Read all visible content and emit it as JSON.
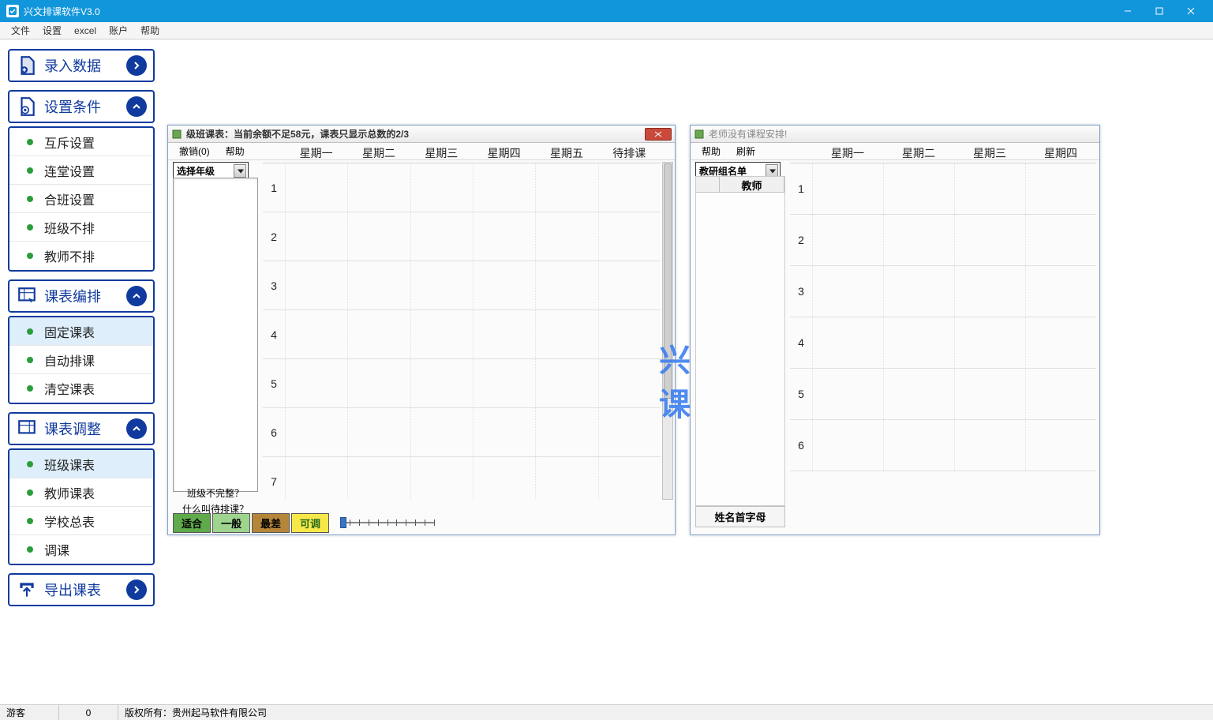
{
  "titlebar": {
    "title": "兴文排课软件V3.0"
  },
  "menubar": {
    "items": [
      "文件",
      "设置",
      "excel",
      "账户",
      "帮助"
    ]
  },
  "sidebar": {
    "sections": [
      {
        "id": "input-data",
        "label": "录入数据",
        "icon": "doc-add",
        "arrow": "right",
        "expanded": false,
        "items": []
      },
      {
        "id": "set-conditions",
        "label": "设置条件",
        "icon": "doc-gear",
        "arrow": "up",
        "expanded": true,
        "items": [
          {
            "id": "exclusion",
            "label": "互斥设置"
          },
          {
            "id": "consecutive",
            "label": "连堂设置"
          },
          {
            "id": "merge-class",
            "label": "合班设置"
          },
          {
            "id": "class-no-schedule",
            "label": "班级不排"
          },
          {
            "id": "teacher-no-schedule",
            "label": "教师不排"
          }
        ]
      },
      {
        "id": "schedule-arrange",
        "label": "课表编排",
        "icon": "grid-cursor",
        "arrow": "up",
        "expanded": true,
        "items": [
          {
            "id": "fixed-schedule",
            "label": "固定课表",
            "active": true
          },
          {
            "id": "auto-schedule",
            "label": "自动排课"
          },
          {
            "id": "clear-schedule",
            "label": "清空课表"
          }
        ]
      },
      {
        "id": "schedule-adjust",
        "label": "课表调整",
        "icon": "grid-box",
        "arrow": "up",
        "expanded": true,
        "items": [
          {
            "id": "class-schedule",
            "label": "班级课表",
            "active": true
          },
          {
            "id": "teacher-schedule",
            "label": "教师课表"
          },
          {
            "id": "school-all",
            "label": "学校总表"
          },
          {
            "id": "swap-class",
            "label": "调课"
          }
        ]
      },
      {
        "id": "export",
        "label": "导出课表",
        "icon": "upload",
        "arrow": "right",
        "expanded": false,
        "items": []
      }
    ]
  },
  "class_window": {
    "title": "级班课表：当前余额不足58元，课表只显示总数的2/3",
    "toolbar": {
      "undo": "撤销(0)",
      "help": "帮助"
    },
    "grade_select": "选择年级",
    "days": [
      "星期一",
      "星期二",
      "星期三",
      "星期四",
      "星期五",
      "待排课"
    ],
    "periods": [
      "1",
      "2",
      "3",
      "4",
      "5",
      "6",
      "7"
    ],
    "hints": {
      "line1": "班级不完整？",
      "line2": "什么叫待排课？"
    },
    "legend": {
      "fit": "适合",
      "general": "一般",
      "worst": "最差",
      "adjustable": "可调"
    }
  },
  "teacher_window": {
    "title": "老师没有课程安排!",
    "toolbar": {
      "help": "帮助",
      "refresh": "刷新"
    },
    "group_select": "教研组名单",
    "teacher_header": "教师",
    "days": [
      "星期一",
      "星期二",
      "星期三",
      "星期四"
    ],
    "periods": [
      "1",
      "2",
      "3",
      "4",
      "5",
      "6"
    ],
    "hint": "姓名首字母"
  },
  "statusbar": {
    "guest": "游客",
    "number": "0",
    "copyright": "版权所有：贵州起马软件有限公司"
  },
  "decor": {
    "line1": "兴",
    "line2": "课"
  }
}
